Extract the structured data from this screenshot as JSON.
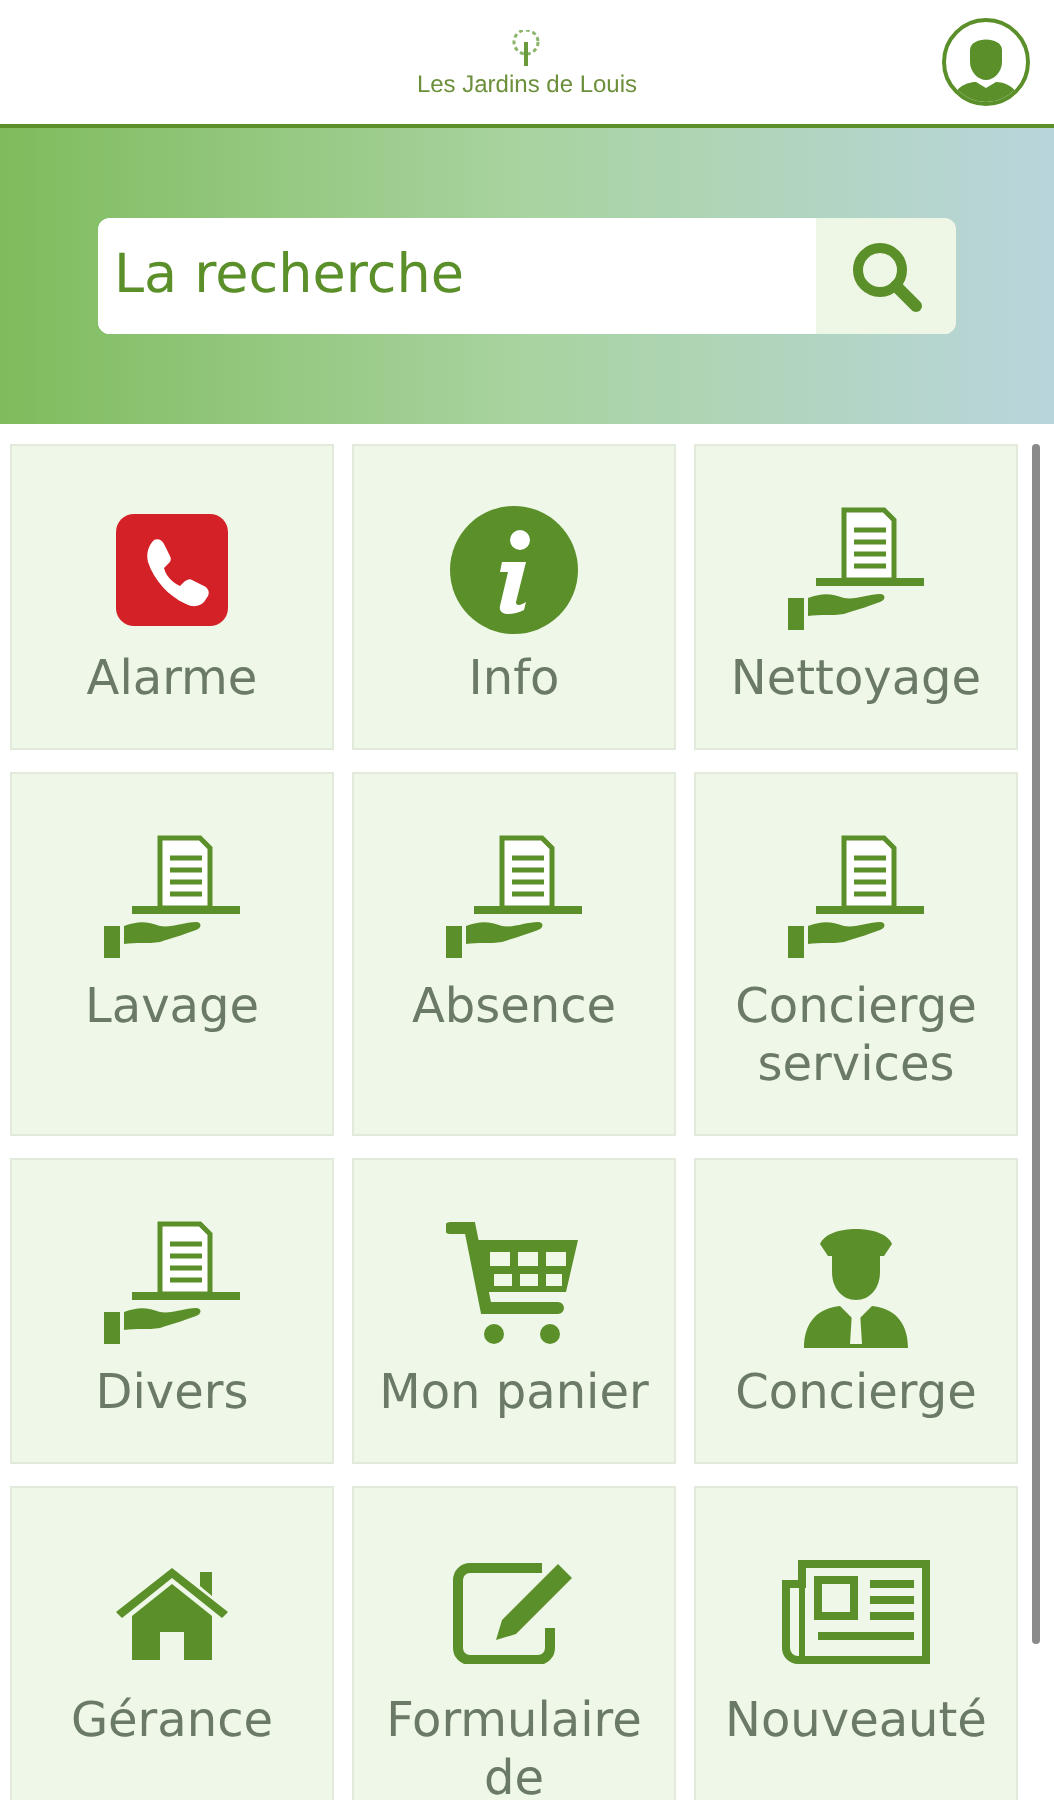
{
  "header": {
    "title": "Les Jardins de Louis"
  },
  "search": {
    "placeholder": "La recherche"
  },
  "tiles": [
    {
      "label": "Alarme",
      "kind": "phone"
    },
    {
      "label": "Info",
      "kind": "info"
    },
    {
      "label": "Nettoyage",
      "kind": "service"
    },
    {
      "label": "Lavage",
      "kind": "service"
    },
    {
      "label": "Absence",
      "kind": "service"
    },
    {
      "label": "Concierge services",
      "kind": "service"
    },
    {
      "label": "Divers",
      "kind": "service"
    },
    {
      "label": "Mon panier",
      "kind": "cart"
    },
    {
      "label": "Concierge",
      "kind": "concierge"
    },
    {
      "label": "Gérance",
      "kind": "home"
    },
    {
      "label": "Formulaire de",
      "kind": "edit"
    },
    {
      "label": "Nouveauté",
      "kind": "news"
    }
  ]
}
